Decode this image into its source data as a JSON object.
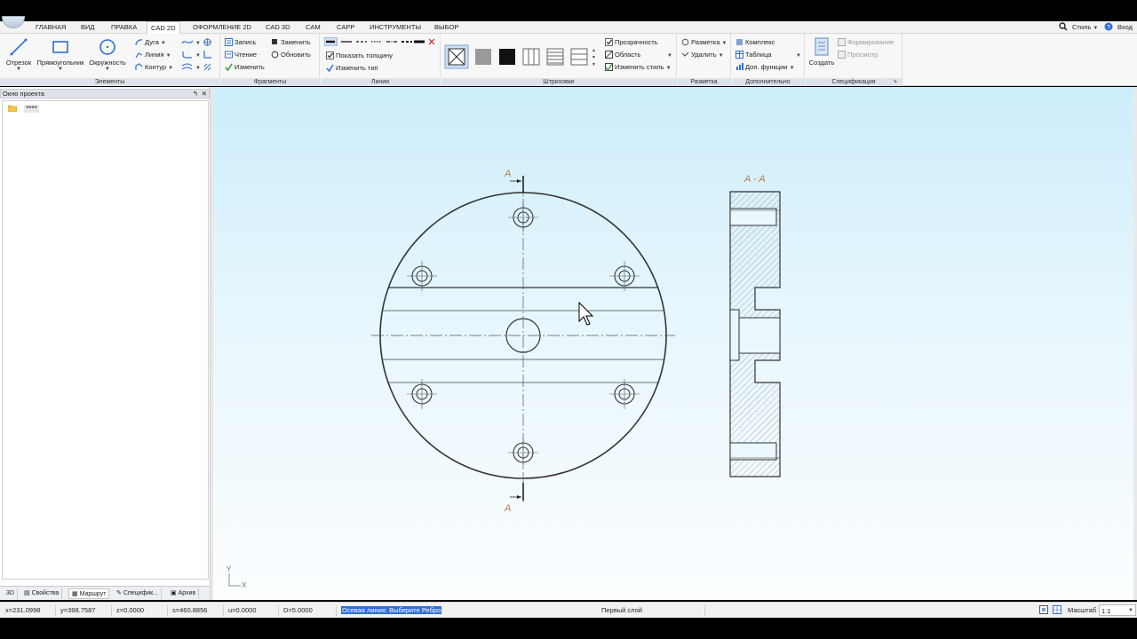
{
  "menubar": {
    "tabs": [
      "ГЛАВНАЯ",
      "ВИД",
      "ПРАВКА",
      "CAD 2D",
      "ОФОРМЛЕНИЕ 2D",
      "CAD 3D",
      "CAM",
      "CAPP",
      "ИНСТРУМЕНТЫ",
      "ВЫБОР"
    ],
    "active_tab": "CAD 2D",
    "style_label": "Стиль",
    "login_label": "Вход"
  },
  "ribbon": {
    "elements": {
      "title": "Элементы",
      "segment": "Отрезок",
      "rectangle": "Прямоугольник",
      "circle": "Окружность",
      "arc": "Дуга",
      "line": "Линия",
      "contour": "Контур"
    },
    "fragments": {
      "title": "Фрагменты",
      "record": "Запись",
      "read": "Чтение",
      "edit": "Изменить",
      "replace": "Заменить",
      "refresh": "Обновить"
    },
    "lines": {
      "title": "Линии",
      "show_thickness": "Показать толщину",
      "change_type": "Изменить тип"
    },
    "hatching": {
      "title": "Штриховки",
      "transparency": "Прозрачность",
      "area": "Область",
      "change_style": "Изменить стиль"
    },
    "markup": {
      "title": "Разметка",
      "markup": "Разметка",
      "delete": "Удалить"
    },
    "extra": {
      "title": "Дополнительно",
      "complex": "Комплекс",
      "table": "Таблица",
      "more_functions": "Доп. функции"
    },
    "spec": {
      "title": "Спецификация",
      "create": "Создать",
      "formation": "Формирование",
      "preview": "Просмотр"
    }
  },
  "left_panel": {
    "title": "Окно проекта",
    "tree_item": "****",
    "tabs": [
      "3D",
      "Свойства",
      "Маршрут",
      "Специфик...",
      "Архив"
    ],
    "active_tab": "Маршрут"
  },
  "drawing": {
    "section_label_top": "A",
    "section_label_bottom": "A",
    "section_view_title": "A - A",
    "axis_y": "Y",
    "axis_x": "X"
  },
  "status": {
    "x": "x=231.0998",
    "y": "y=398.7587",
    "z": "z=0.0000",
    "s": "s=460.8856",
    "u": "u=0.0000",
    "d": "D=5.0000",
    "prompt": "Осевая линия: Выберите Ребро",
    "layer": "Первый слой",
    "scale_label": "Масштаб",
    "scale_value": "1:1"
  },
  "colors": {
    "accent": "#2f6fd6",
    "drawing_line": "#333333",
    "annotation": "#b87a3c"
  }
}
